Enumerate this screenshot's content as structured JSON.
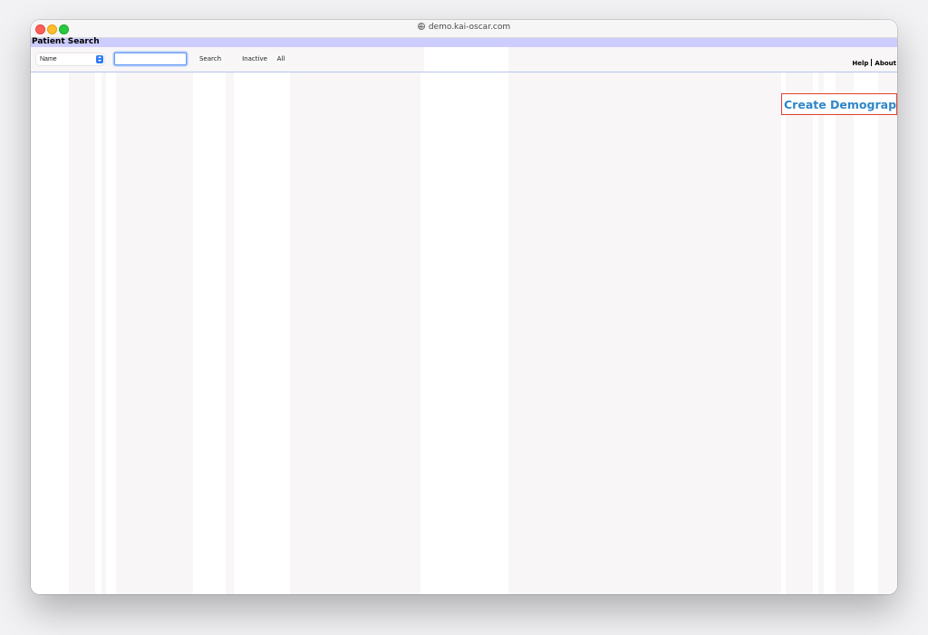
{
  "browser": {
    "url": "demo.kai-oscar.com"
  },
  "header": {
    "title": "Patient Search"
  },
  "search": {
    "type_selected": "Name",
    "query_value": "",
    "search_label": "Search",
    "inactive_label": "Inactive",
    "all_label": "All"
  },
  "links": {
    "help": "Help",
    "about": "About"
  },
  "actions": {
    "create_demographic": "Create Demographic"
  },
  "colors": {
    "header_bg": "#ccccff",
    "link_blue": "#2f86c8",
    "highlight_red": "#e0412b",
    "focus_blue": "#6a9ef5"
  }
}
